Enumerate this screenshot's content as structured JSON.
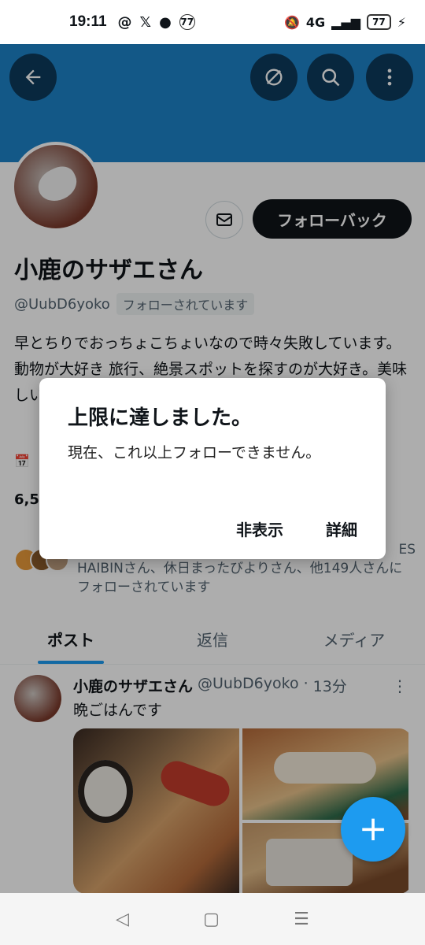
{
  "status_bar": {
    "time": "19:11",
    "icons": [
      "threads-icon",
      "x-icon",
      "bulb-icon",
      "77-badge-icon"
    ],
    "network": "4G",
    "battery": "77"
  },
  "header": {
    "back_icon": "arrow-left-icon",
    "grok_icon": "circle-slash-icon",
    "search_icon": "search-icon",
    "more_icon": "more-vertical-icon",
    "banner_color": "#1d82c8"
  },
  "profile": {
    "name": "小鹿のサザエさん",
    "handle": "@UubD6yoko",
    "follows_you_badge": "フォローされています",
    "follow_back_label": "フォローバック",
    "bio": "早とちりでおっちょこちょいなので時々失敗しています。動物が大好き 旅行、絶景スポットを探すのが大好き。美味しい食べ物、お酒が大好き。好きな季節の食事",
    "joined": "",
    "stats": "6,5",
    "followed_by_overflow": "ES",
    "followed_by": "HAIBINさん、休日まったびよりさん、他149人さんにフォローされています"
  },
  "tabs": [
    {
      "label": "ポスト",
      "active": true
    },
    {
      "label": "返信",
      "active": false
    },
    {
      "label": "メディア",
      "active": false
    }
  ],
  "tweet": {
    "author": "小鹿のサザエさん",
    "handle": "@UubD6yoko",
    "time": "13分",
    "text": "晩ごはんです",
    "photos": [
      "soup-and-sushi-photo",
      "nigiri-sushi-photo",
      "grilled-fish-photo"
    ]
  },
  "fab": {
    "label": "+"
  },
  "dialog": {
    "title": "上限に達しました。",
    "message": "現在、これ以上フォローできません。",
    "hide_label": "非表示",
    "details_label": "詳細"
  },
  "nav": {
    "back": "◁",
    "home": "▢",
    "menu": "☰"
  }
}
